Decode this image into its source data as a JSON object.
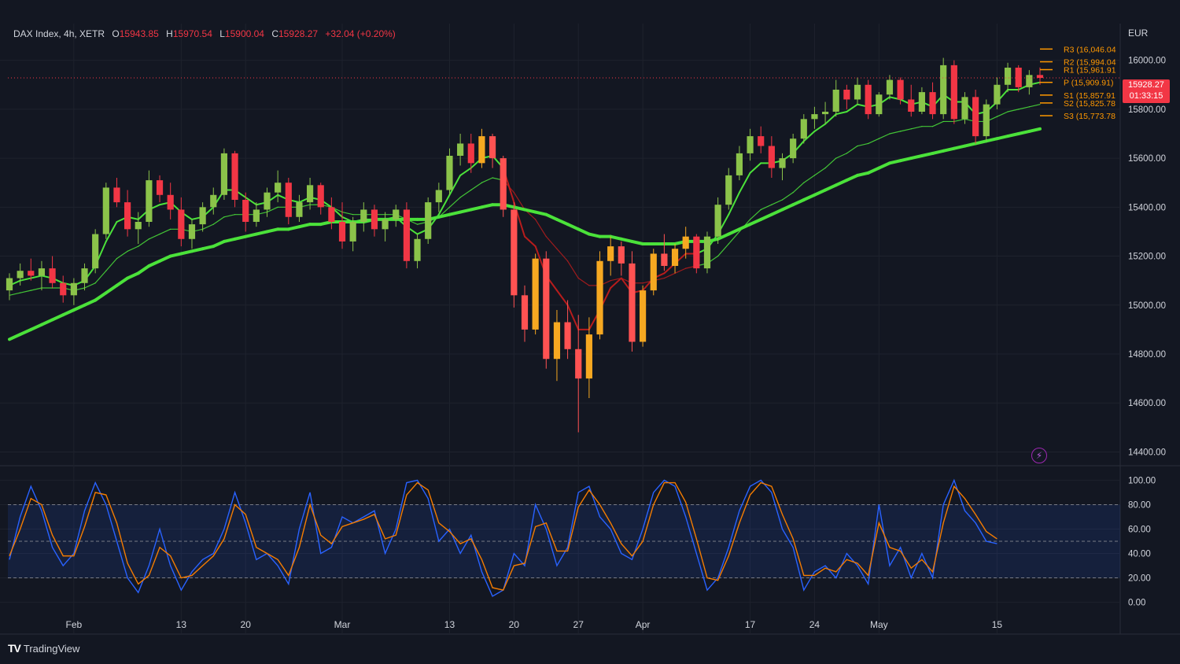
{
  "legend": {
    "symbol": "DAX Index, 4h, XETR",
    "open_label": "O",
    "open": "15943.85",
    "high_label": "H",
    "high": "15970.54",
    "low_label": "L",
    "low": "15900.04",
    "close_label": "C",
    "close": "15928.27",
    "change": "+32.04 (+0.20%)"
  },
  "currency": "EUR",
  "price_tag": {
    "price": "15928.27",
    "countdown": "01:33:15"
  },
  "brand": {
    "logo": "TV",
    "name": "TradingView"
  },
  "colors": {
    "up": "#089981",
    "down": "#f23645",
    "ma_green": "#4be23a",
    "ma_red": "#b71c1c",
    "stoch_k": "#2962ff",
    "stoch_d": "#f57c00",
    "pivot": "#ff9800"
  },
  "chart_data": [
    {
      "type": "line",
      "title": "",
      "ylim": [
        14350,
        16150
      ],
      "y_ticks": [
        16000,
        15800,
        15600,
        15400,
        15200,
        15000,
        14800,
        14600,
        14400
      ],
      "y_tick_labels": [
        "16000.00",
        "15800.00",
        "15600.00",
        "15400.00",
        "15200.00",
        "15000.00",
        "14800.00",
        "14600.00",
        "14400.00"
      ],
      "x_tick_labels": [
        "Feb",
        "13",
        "20",
        "Mar",
        "13",
        "20",
        "27",
        "Apr",
        "17",
        "24",
        "May",
        "15"
      ],
      "x_tick_index": [
        6,
        16,
        22,
        31,
        41,
        47,
        53,
        59,
        69,
        75,
        81,
        92
      ],
      "grid": true,
      "candles": [
        [
          15060,
          15130,
          15020,
          15110
        ],
        [
          15110,
          15170,
          15080,
          15140
        ],
        [
          15140,
          15190,
          15100,
          15120
        ],
        [
          15120,
          15180,
          15060,
          15150
        ],
        [
          15150,
          15200,
          15070,
          15090
        ],
        [
          15090,
          15120,
          15010,
          15040
        ],
        [
          15040,
          15110,
          15000,
          15090
        ],
        [
          15090,
          15170,
          15060,
          15150
        ],
        [
          15150,
          15310,
          15130,
          15290
        ],
        [
          15290,
          15500,
          15270,
          15480
        ],
        [
          15480,
          15520,
          15400,
          15420
        ],
        [
          15420,
          15470,
          15280,
          15310
        ],
        [
          15310,
          15380,
          15250,
          15340
        ],
        [
          15340,
          15550,
          15320,
          15510
        ],
        [
          15510,
          15530,
          15420,
          15450
        ],
        [
          15450,
          15500,
          15350,
          15390
        ],
        [
          15390,
          15440,
          15240,
          15270
        ],
        [
          15270,
          15350,
          15230,
          15330
        ],
        [
          15330,
          15420,
          15300,
          15400
        ],
        [
          15400,
          15480,
          15370,
          15450
        ],
        [
          15450,
          15640,
          15430,
          15620
        ],
        [
          15620,
          15630,
          15400,
          15430
        ],
        [
          15430,
          15460,
          15300,
          15340
        ],
        [
          15340,
          15420,
          15320,
          15390
        ],
        [
          15390,
          15480,
          15360,
          15460
        ],
        [
          15460,
          15550,
          15420,
          15500
        ],
        [
          15500,
          15520,
          15330,
          15360
        ],
        [
          15360,
          15450,
          15340,
          15420
        ],
        [
          15420,
          15520,
          15390,
          15490
        ],
        [
          15490,
          15500,
          15370,
          15400
        ],
        [
          15400,
          15440,
          15310,
          15340
        ],
        [
          15340,
          15420,
          15230,
          15260
        ],
        [
          15260,
          15360,
          15220,
          15340
        ],
        [
          15340,
          15420,
          15300,
          15390
        ],
        [
          15390,
          15410,
          15280,
          15310
        ],
        [
          15310,
          15380,
          15260,
          15350
        ],
        [
          15350,
          15410,
          15320,
          15390
        ],
        [
          15390,
          15420,
          15150,
          15180
        ],
        [
          15180,
          15290,
          15150,
          15270
        ],
        [
          15270,
          15440,
          15250,
          15420
        ],
        [
          15420,
          15500,
          15380,
          15470
        ],
        [
          15470,
          15640,
          15450,
          15610
        ],
        [
          15610,
          15700,
          15570,
          15660
        ],
        [
          15660,
          15700,
          15540,
          15580
        ],
        [
          15580,
          15720,
          15560,
          15690
        ],
        [
          15690,
          15700,
          15560,
          15600
        ],
        [
          15600,
          15610,
          15360,
          15390
        ],
        [
          15390,
          15420,
          14990,
          15040
        ],
        [
          15040,
          15080,
          14850,
          14900
        ],
        [
          14900,
          15210,
          14880,
          15190
        ],
        [
          15190,
          15220,
          14740,
          14780
        ],
        [
          14780,
          14980,
          14690,
          14930
        ],
        [
          14930,
          15020,
          14780,
          14820
        ],
        [
          14820,
          14960,
          14480,
          14700
        ],
        [
          14700,
          14950,
          14620,
          14880
        ],
        [
          14880,
          15220,
          14860,
          15180
        ],
        [
          15180,
          15280,
          15120,
          15240
        ],
        [
          15240,
          15260,
          15120,
          15170
        ],
        [
          15170,
          15220,
          14810,
          14850
        ],
        [
          14850,
          15080,
          14830,
          15060
        ],
        [
          15060,
          15230,
          15040,
          15210
        ],
        [
          15210,
          15290,
          15140,
          15160
        ],
        [
          15160,
          15250,
          15130,
          15230
        ],
        [
          15230,
          15320,
          15190,
          15280
        ],
        [
          15280,
          15290,
          15130,
          15150
        ],
        [
          15150,
          15300,
          15130,
          15280
        ],
        [
          15280,
          15440,
          15250,
          15410
        ],
        [
          15410,
          15560,
          15390,
          15530
        ],
        [
          15530,
          15650,
          15510,
          15620
        ],
        [
          15620,
          15720,
          15590,
          15690
        ],
        [
          15690,
          15730,
          15620,
          15650
        ],
        [
          15650,
          15690,
          15520,
          15560
        ],
        [
          15560,
          15620,
          15510,
          15600
        ],
        [
          15600,
          15700,
          15580,
          15680
        ],
        [
          15680,
          15780,
          15660,
          15760
        ],
        [
          15760,
          15810,
          15720,
          15780
        ],
        [
          15780,
          15830,
          15740,
          15790
        ],
        [
          15790,
          15920,
          15770,
          15880
        ],
        [
          15880,
          15900,
          15800,
          15840
        ],
        [
          15840,
          15930,
          15820,
          15900
        ],
        [
          15900,
          15920,
          15760,
          15780
        ],
        [
          15780,
          15870,
          15770,
          15860
        ],
        [
          15860,
          15940,
          15840,
          15920
        ],
        [
          15920,
          15930,
          15820,
          15840
        ],
        [
          15840,
          15900,
          15770,
          15790
        ],
        [
          15790,
          15890,
          15780,
          15870
        ],
        [
          15870,
          15910,
          15760,
          15780
        ],
        [
          15780,
          16010,
          15760,
          15980
        ],
        [
          15980,
          16000,
          15740,
          15760
        ],
        [
          15760,
          15870,
          15740,
          15850
        ],
        [
          15850,
          15880,
          15660,
          15690
        ],
        [
          15690,
          15840,
          15670,
          15820
        ],
        [
          15820,
          15930,
          15800,
          15900
        ],
        [
          15900,
          15990,
          15870,
          15970
        ],
        [
          15970,
          15980,
          15870,
          15890
        ],
        [
          15890,
          15960,
          15860,
          15940
        ],
        [
          15940,
          15971,
          15900,
          15928
        ]
      ],
      "series": [
        {
          "values": [
            15080,
            15100,
            15110,
            15120,
            15110,
            15090,
            15080,
            15100,
            15160,
            15260,
            15340,
            15360,
            15350,
            15390,
            15410,
            15420,
            15380,
            15350,
            15360,
            15400,
            15470,
            15470,
            15440,
            15410,
            15420,
            15450,
            15430,
            15420,
            15440,
            15430,
            15400,
            15360,
            15340,
            15350,
            15350,
            15350,
            15360,
            15320,
            15290,
            15310,
            15370,
            15450,
            15530,
            15560,
            15600,
            15610,
            15560,
            15420,
            15280,
            15240,
            15120,
            15060,
            15000,
            14900,
            14900,
            14980,
            15070,
            15110,
            15050,
            15060,
            15110,
            15130,
            15170,
            15210,
            15210,
            15230,
            15290,
            15370,
            15460,
            15540,
            15580,
            15580,
            15590,
            15620,
            15670,
            15710,
            15740,
            15780,
            15790,
            15820,
            15810,
            15820,
            15850,
            15840,
            15820,
            15830,
            15810,
            15860,
            15830,
            15830,
            15780,
            15790,
            15830,
            15880,
            15880,
            15900,
            15910
          ]
        },
        {
          "values": [
            15040,
            15050,
            15060,
            15070,
            15070,
            15070,
            15060,
            15070,
            15090,
            15140,
            15190,
            15220,
            15240,
            15270,
            15290,
            15310,
            15310,
            15300,
            15310,
            15330,
            15360,
            15370,
            15370,
            15370,
            15380,
            15400,
            15400,
            15400,
            15410,
            15410,
            15400,
            15380,
            15370,
            15370,
            15370,
            15370,
            15370,
            15350,
            15330,
            15340,
            15360,
            15400,
            15440,
            15470,
            15500,
            15520,
            15510,
            15460,
            15390,
            15350,
            15280,
            15230,
            15180,
            15110,
            15080,
            15080,
            15100,
            15110,
            15090,
            15090,
            15100,
            15110,
            15130,
            15150,
            15160,
            15170,
            15200,
            15250,
            15300,
            15350,
            15390,
            15410,
            15430,
            15460,
            15500,
            15530,
            15560,
            15600,
            15620,
            15650,
            15660,
            15680,
            15700,
            15710,
            15720,
            15730,
            15730,
            15750,
            15750,
            15760,
            15750,
            15750,
            15770,
            15790,
            15800,
            15810,
            15820
          ]
        },
        {
          "values": [
            14860,
            14880,
            14900,
            14920,
            14940,
            14960,
            14980,
            15000,
            15020,
            15050,
            15080,
            15110,
            15130,
            15160,
            15180,
            15200,
            15210,
            15220,
            15230,
            15240,
            15260,
            15270,
            15280,
            15290,
            15300,
            15310,
            15310,
            15320,
            15330,
            15330,
            15340,
            15340,
            15340,
            15340,
            15350,
            15350,
            15350,
            15350,
            15350,
            15350,
            15360,
            15370,
            15380,
            15390,
            15400,
            15410,
            15410,
            15400,
            15390,
            15380,
            15370,
            15350,
            15330,
            15310,
            15290,
            15280,
            15280,
            15270,
            15260,
            15250,
            15250,
            15250,
            15250,
            15260,
            15260,
            15260,
            15270,
            15290,
            15310,
            15330,
            15350,
            15370,
            15390,
            15410,
            15430,
            15450,
            15470,
            15490,
            15510,
            15530,
            15540,
            15560,
            15580,
            15590,
            15600,
            15610,
            15620,
            15630,
            15640,
            15650,
            15660,
            15670,
            15680,
            15690,
            15700,
            15710,
            15720
          ]
        }
      ],
      "pivots": [
        {
          "label": "R3 (16,046.04",
          "value": 16046.04
        },
        {
          "label": "R2 (15,994.04",
          "value": 15994.04
        },
        {
          "label": "R1 (15,961.91",
          "value": 15961.91
        },
        {
          "label": "P (15,909.91)",
          "value": 15909.91
        },
        {
          "label": "S1 (15,857.91",
          "value": 15857.91
        },
        {
          "label": "S2 (15,825.78",
          "value": 15825.78
        },
        {
          "label": "S3 (15,773.78",
          "value": 15773.78
        }
      ]
    },
    {
      "type": "line",
      "title": "",
      "ylim": [
        -8,
        108
      ],
      "y_ticks": [
        100,
        80,
        60,
        40,
        20,
        0
      ],
      "y_tick_labels": [
        "100.00",
        "80.00",
        "60.00",
        "40.00",
        "20.00",
        "0.00"
      ],
      "band": [
        20,
        80
      ],
      "series": [
        {
          "values": [
            35,
            70,
            95,
            75,
            45,
            30,
            40,
            75,
            98,
            80,
            50,
            20,
            8,
            30,
            60,
            30,
            10,
            25,
            35,
            40,
            60,
            90,
            65,
            35,
            40,
            30,
            15,
            60,
            90,
            40,
            45,
            70,
            65,
            70,
            75,
            40,
            60,
            98,
            100,
            85,
            50,
            60,
            40,
            55,
            25,
            5,
            10,
            40,
            30,
            80,
            60,
            30,
            45,
            90,
            95,
            70,
            60,
            40,
            35,
            60,
            90,
            100,
            95,
            70,
            40,
            10,
            20,
            45,
            75,
            95,
            100,
            90,
            60,
            45,
            10,
            25,
            30,
            20,
            40,
            30,
            15,
            80,
            30,
            45,
            20,
            40,
            20,
            80,
            100,
            75,
            65,
            50,
            48
          ]
        },
        {
          "values": [
            38,
            60,
            85,
            80,
            55,
            38,
            38,
            62,
            90,
            88,
            65,
            32,
            15,
            22,
            45,
            38,
            20,
            22,
            30,
            38,
            52,
            80,
            72,
            45,
            40,
            35,
            22,
            45,
            80,
            55,
            48,
            62,
            65,
            68,
            72,
            52,
            55,
            88,
            98,
            92,
            65,
            58,
            48,
            52,
            35,
            12,
            10,
            30,
            32,
            62,
            65,
            42,
            42,
            78,
            92,
            80,
            65,
            48,
            38,
            50,
            80,
            98,
            98,
            82,
            52,
            20,
            18,
            38,
            65,
            88,
            98,
            95,
            72,
            52,
            22,
            22,
            28,
            25,
            35,
            32,
            22,
            65,
            45,
            42,
            28,
            35,
            25,
            65,
            95,
            85,
            72,
            58,
            52
          ]
        }
      ]
    }
  ]
}
